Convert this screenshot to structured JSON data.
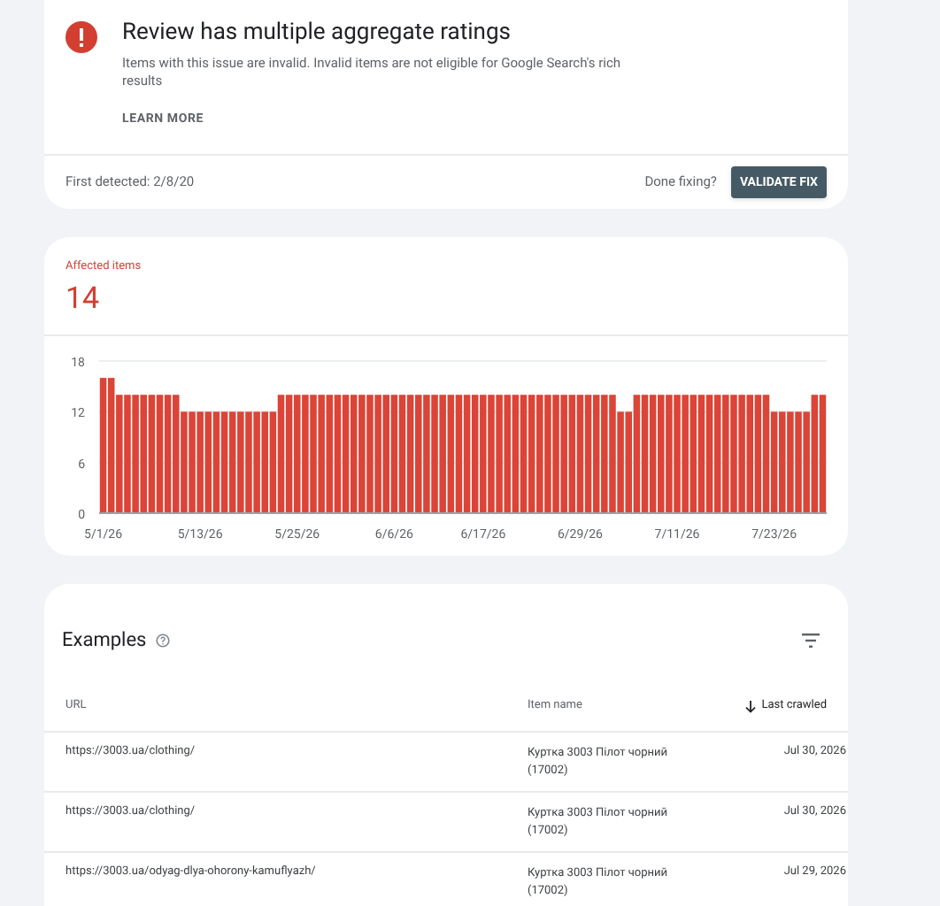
{
  "issue": {
    "title": "Review has multiple aggregate ratings",
    "description": "Items with this issue are invalid. Invalid items are not eligible for Google Search's rich results",
    "learn_more": "LEARN MORE",
    "first_detected": "First detected: 2/8/20",
    "done_fixing": "Done fixing?",
    "validate_button": "VALIDATE FIX"
  },
  "affected": {
    "label": "Affected items",
    "count": "14",
    "chart_data": {
      "type": "bar",
      "categories": [
        "5/1/26",
        null,
        null,
        null,
        null,
        null,
        null,
        null,
        null,
        null,
        null,
        null,
        "5/13/26",
        null,
        null,
        null,
        null,
        null,
        null,
        null,
        null,
        null,
        null,
        null,
        "5/25/26",
        null,
        null,
        null,
        null,
        null,
        null,
        null,
        null,
        null,
        null,
        null,
        "6/6/26",
        null,
        null,
        null,
        null,
        null,
        null,
        null,
        null,
        null,
        null,
        "6/17/26",
        null,
        null,
        null,
        null,
        null,
        null,
        null,
        null,
        null,
        null,
        null,
        "6/29/26",
        null,
        null,
        null,
        null,
        null,
        null,
        null,
        null,
        null,
        null,
        null,
        "7/11/26",
        null,
        null,
        null,
        null,
        null,
        null,
        null,
        null,
        null,
        null,
        null,
        "7/23/26",
        null,
        null,
        null,
        null,
        null,
        null
      ],
      "series": [
        {
          "color": "#db4437",
          "values": [
            16,
            16,
            14,
            14,
            14,
            14,
            14,
            14,
            14,
            14,
            12,
            12,
            12,
            12,
            12,
            12,
            12,
            12,
            12,
            12,
            12,
            12,
            14,
            14,
            14,
            14,
            14,
            14,
            14,
            14,
            14,
            14,
            14,
            14,
            14,
            14,
            14,
            14,
            14,
            14,
            14,
            14,
            14,
            14,
            14,
            14,
            14,
            14,
            14,
            14,
            14,
            14,
            14,
            14,
            14,
            14,
            14,
            14,
            14,
            14,
            14,
            14,
            14,
            14,
            12,
            12,
            14,
            14,
            14,
            14,
            14,
            14,
            14,
            14,
            14,
            14,
            14,
            14,
            14,
            14,
            14,
            14,
            14,
            12,
            12,
            12,
            12,
            12,
            14,
            14
          ]
        }
      ],
      "ylim": [
        0,
        18
      ],
      "yticks": [
        0,
        6,
        12,
        18
      ]
    }
  },
  "examples": {
    "title": "Examples",
    "columns": [
      "URL",
      "Item name",
      "Last crawled"
    ],
    "rows": [
      {
        "url": "https://3003.ua/clothing/",
        "item_name": "Куртка 3003 Пілот чорний (17002)",
        "last_crawled": "Jul 30, 2026"
      },
      {
        "url": "https://3003.ua/clothing/",
        "item_name": "Куртка 3003 Пілот чорний (17002)",
        "last_crawled": "Jul 30, 2026"
      },
      {
        "url": "https://3003.ua/odyag-dlya-ohorony-kamuflyazh/",
        "item_name": "Куртка 3003 Пілот чорний (17002)",
        "last_crawled": "Jul 29, 2026"
      }
    ]
  }
}
